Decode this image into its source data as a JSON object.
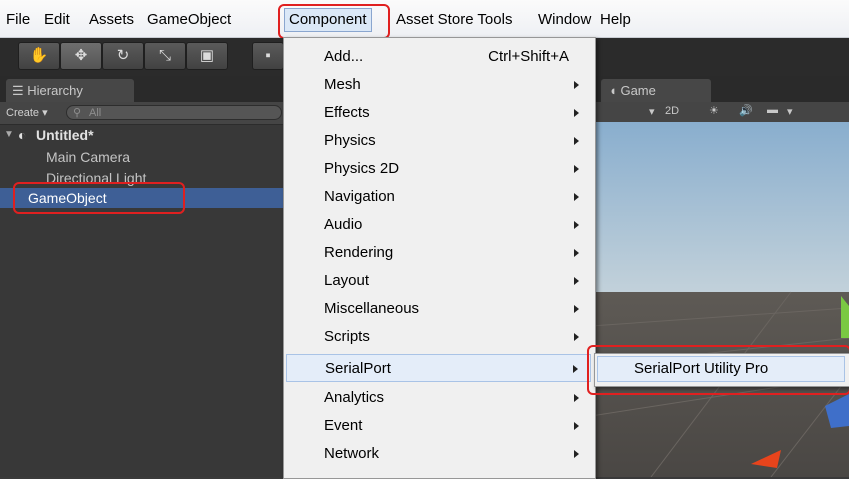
{
  "menubar": {
    "items": [
      "File",
      "Edit",
      "Assets",
      "GameObject",
      "Component",
      "Asset Store Tools",
      "Window",
      "Help"
    ],
    "active": "Component"
  },
  "toolbar": {
    "tools": [
      "hand-tool",
      "move-tool",
      "rotate-tool",
      "scale-tool",
      "rect-tool"
    ]
  },
  "hierarchy": {
    "tab_label": "Hierarchy",
    "create_label": "Create",
    "search_placeholder": "All",
    "scene_name": "Untitled*",
    "items": [
      "Main Camera",
      "Directional Light",
      "GameObject"
    ],
    "selected": "GameObject"
  },
  "game_view": {
    "tab_label": "Game",
    "mode_2d": "2D"
  },
  "component_menu": {
    "items": [
      {
        "label": "Add...",
        "shortcut": "Ctrl+Shift+A",
        "submenu": false
      },
      {
        "label": "Mesh",
        "submenu": true
      },
      {
        "label": "Effects",
        "submenu": true
      },
      {
        "label": "Physics",
        "submenu": true
      },
      {
        "label": "Physics 2D",
        "submenu": true
      },
      {
        "label": "Navigation",
        "submenu": true
      },
      {
        "label": "Audio",
        "submenu": true
      },
      {
        "label": "Rendering",
        "submenu": true
      },
      {
        "label": "Layout",
        "submenu": true
      },
      {
        "label": "Miscellaneous",
        "submenu": true
      },
      {
        "label": "Scripts",
        "submenu": true
      },
      {
        "label": "SerialPort",
        "submenu": true
      },
      {
        "label": "Analytics",
        "submenu": true
      },
      {
        "label": "Event",
        "submenu": true
      },
      {
        "label": "Network",
        "submenu": true
      }
    ],
    "highlighted": "SerialPort"
  },
  "serialport_submenu": {
    "items": [
      "SerialPort Utility Pro"
    ]
  },
  "colors": {
    "highlight_box": "#e02020",
    "selection": "#3e5f96"
  }
}
